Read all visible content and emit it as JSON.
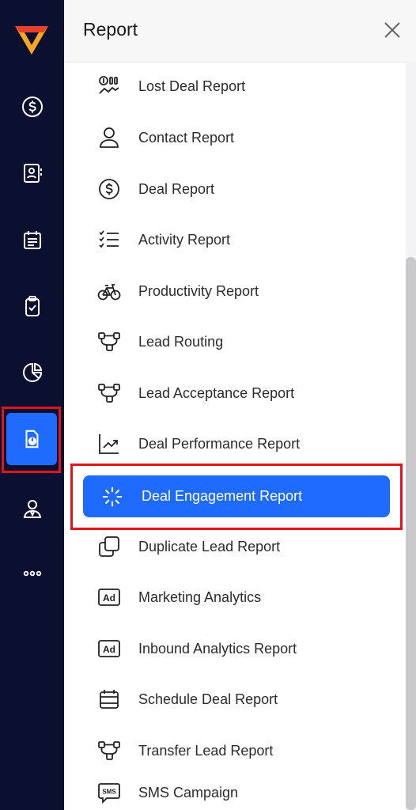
{
  "panel": {
    "title": "Report",
    "items": [
      {
        "label": "Lost Deal Report",
        "icon": "money-trend-icon"
      },
      {
        "label": "Contact Report",
        "icon": "person-icon"
      },
      {
        "label": "Deal Report",
        "icon": "dollar-circle-icon"
      },
      {
        "label": "Activity Report",
        "icon": "checklist-icon"
      },
      {
        "label": "Productivity Report",
        "icon": "bicycle-icon"
      },
      {
        "label": "Lead Routing",
        "icon": "routing-nodes-icon"
      },
      {
        "label": "Lead Acceptance Report",
        "icon": "routing-nodes-icon"
      },
      {
        "label": "Deal Performance Report",
        "icon": "trend-chart-icon"
      },
      {
        "label": "Deal Engagement Report",
        "icon": "loading-spinner-icon",
        "active": true
      },
      {
        "label": "Duplicate Lead Report",
        "icon": "duplicate-icon"
      },
      {
        "label": "Marketing Analytics",
        "icon": "ad-icon"
      },
      {
        "label": "Inbound Analytics Report",
        "icon": "ad-icon"
      },
      {
        "label": "Schedule Deal Report",
        "icon": "calendar-icon"
      },
      {
        "label": "Transfer Lead Report",
        "icon": "routing-nodes-icon"
      },
      {
        "label": "SMS Campaign",
        "icon": "sms-icon"
      }
    ]
  },
  "rail": {
    "items": [
      "dollar-circle-icon",
      "contact-book-icon",
      "calendar-icon",
      "clipboard-check-icon",
      "pie-chart-icon",
      "report-icon",
      "user-tie-icon",
      "more-icon"
    ],
    "active": "report-icon"
  },
  "colors": {
    "rail_bg": "#0b1030",
    "accent": "#1f6bff",
    "highlight": "#e0161c"
  }
}
